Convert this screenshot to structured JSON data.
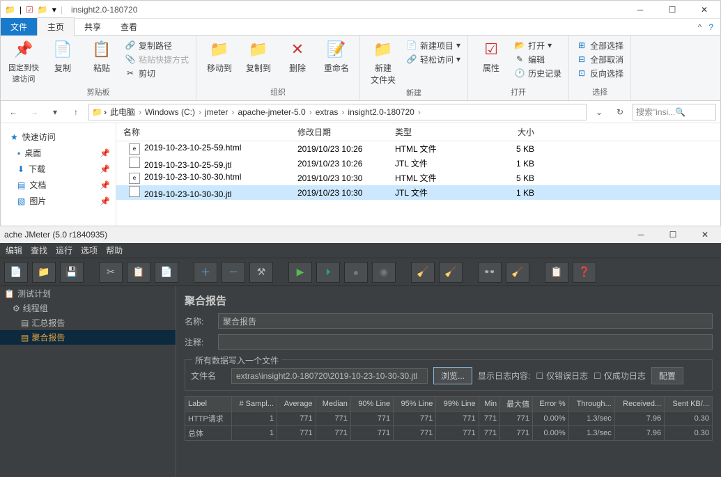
{
  "explorer": {
    "title": "insight2.0-180720",
    "tabs": {
      "file": "文件",
      "home": "主页",
      "share": "共享",
      "view": "查看"
    },
    "ribbon": {
      "pin": "固定到快\n速访问",
      "copy": "复制",
      "paste": "粘贴",
      "copy_path": "复制路径",
      "paste_shortcut": "粘贴快捷方式",
      "cut": "剪切",
      "clipboard": "剪贴板",
      "move_to": "移动到",
      "copy_to": "复制到",
      "delete": "删除",
      "rename": "重命名",
      "organize": "组织",
      "new_folder": "新建\n文件夹",
      "new_item": "新建项目",
      "easy_access": "轻松访问",
      "new": "新建",
      "properties": "属性",
      "open": "打开",
      "edit": "编辑",
      "history": "历史记录",
      "open_group": "打开",
      "select_all": "全部选择",
      "select_none": "全部取消",
      "invert": "反向选择",
      "select": "选择"
    },
    "breadcrumbs": [
      "此电脑",
      "Windows (C:)",
      "jmeter",
      "apache-jmeter-5.0",
      "extras",
      "insight2.0-180720"
    ],
    "search_placeholder": "搜索\"insi...",
    "sidebar": [
      {
        "label": "快速访问",
        "icon": "★",
        "hdr": true
      },
      {
        "label": "桌面",
        "icon": "▪",
        "pin": true
      },
      {
        "label": "下载",
        "icon": "⬇",
        "pin": true
      },
      {
        "label": "文档",
        "icon": "▤",
        "pin": true
      },
      {
        "label": "图片",
        "icon": "▧",
        "pin": true
      }
    ],
    "columns": {
      "name": "名称",
      "date": "修改日期",
      "type": "类型",
      "size": "大小"
    },
    "files": [
      {
        "name": "2019-10-23-10-25-59.html",
        "date": "2019/10/23 10:26",
        "type": "HTML 文件",
        "size": "5 KB",
        "ico": "e"
      },
      {
        "name": "2019-10-23-10-25-59.jtl",
        "date": "2019/10/23 10:26",
        "type": "JTL 文件",
        "size": "1 KB",
        "ico": ""
      },
      {
        "name": "2019-10-23-10-30-30.html",
        "date": "2019/10/23 10:30",
        "type": "HTML 文件",
        "size": "5 KB",
        "ico": "e"
      },
      {
        "name": "2019-10-23-10-30-30.jtl",
        "date": "2019/10/23 10:30",
        "type": "JTL 文件",
        "size": "1 KB",
        "ico": "",
        "sel": true
      }
    ]
  },
  "jmeter": {
    "title": "ache JMeter (5.0 r1840935)",
    "menus": [
      "编辑",
      "查找",
      "运行",
      "选项",
      "帮助"
    ],
    "tree": [
      {
        "label": "测试计划",
        "lvl": 0,
        "ico": "📋"
      },
      {
        "label": "线程组",
        "lvl": 1,
        "ico": "⚙"
      },
      {
        "label": "汇总报告",
        "lvl": 2,
        "ico": "▤"
      },
      {
        "label": "聚合报告",
        "lvl": 2,
        "ico": "▤",
        "sel": true
      }
    ],
    "panel": {
      "title": "聚合报告",
      "name_label": "名称:",
      "name_value": "聚合报告",
      "comment_label": "注释:",
      "fieldset_label": "所有数据写入一个文件",
      "filename_label": "文件名",
      "filename_value": "extras\\insight2.0-180720\\2019-10-23-10-30-30.jtl",
      "browse": "浏览...",
      "showlog_label": "显示日志内容:",
      "chk_err": "仅错误日志",
      "chk_ok": "仅成功日志",
      "config": "配置"
    },
    "table": {
      "headers": [
        "Label",
        "# Sampl...",
        "Average",
        "Median",
        "90% Line",
        "95% Line",
        "99% Line",
        "Min",
        "最大值",
        "Error %",
        "Through...",
        "Received...",
        "Sent KB/..."
      ],
      "rows": [
        [
          "HTTP请求",
          "1",
          "771",
          "771",
          "771",
          "771",
          "771",
          "771",
          "771",
          "0.00%",
          "1.3/sec",
          "7.96",
          "0.30"
        ],
        [
          "总体",
          "1",
          "771",
          "771",
          "771",
          "771",
          "771",
          "771",
          "771",
          "0.00%",
          "1.3/sec",
          "7.96",
          "0.30"
        ]
      ]
    }
  }
}
